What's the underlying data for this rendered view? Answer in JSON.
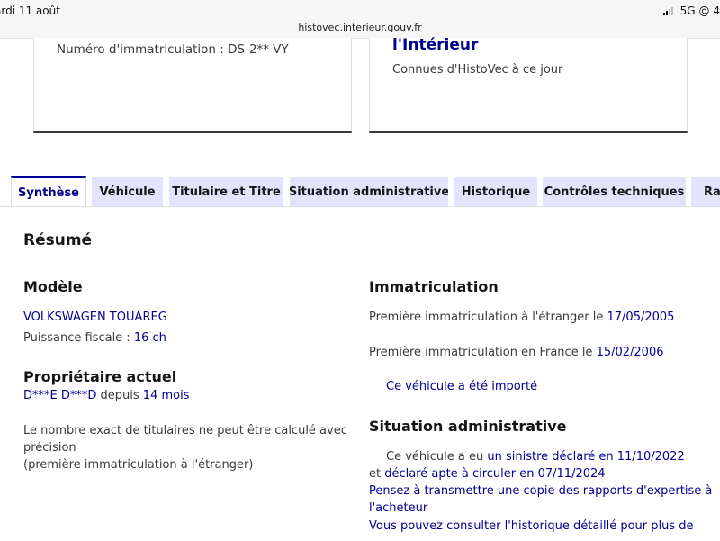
{
  "status_bar": {
    "time": "ardi 11 août",
    "url": "histovec.interieur.gouv.fr",
    "network": "5G",
    "right_extra": "@ 4"
  },
  "card_left": {
    "plate_text": "Numéro d'immatriculation : DS-2**-VY"
  },
  "card_right": {
    "title": "l'Intérieur",
    "subtitle": "Connues d'HistoVec à ce jour"
  },
  "tabs": [
    {
      "label": "Synthèse",
      "active": true
    },
    {
      "label": "Véhicule",
      "active": false
    },
    {
      "label": "Titulaire et Titre",
      "active": false
    },
    {
      "label": "Situation administrative",
      "active": false
    },
    {
      "label": "Historique",
      "active": false
    },
    {
      "label": "Contrôles techniques",
      "active": false
    },
    {
      "label": "Rap",
      "active": false
    }
  ],
  "summary": {
    "heading": "Résumé",
    "model": {
      "heading": "Modèle",
      "name": "VOLKSWAGEN TOUAREG",
      "power_label": "Puissance fiscale : ",
      "power_value": "16 ch"
    },
    "owner": {
      "heading": "Propriétaire actuel",
      "name": "D***E D***D",
      "since_label": " depuis ",
      "since_value": "14 mois",
      "note_line1": "Le nombre exact de titulaires ne peut être calculé avec",
      "note_line2": "précision",
      "note_line3": "(première immatriculation à l'étranger)"
    },
    "registration": {
      "heading": "Immatriculation",
      "foreign_label": "Première immatriculation à l'étranger le ",
      "foreign_date": "17/05/2005",
      "france_label": "Première immatriculation en France le ",
      "france_date": "15/02/2006",
      "imported": "Ce véhicule a été importé"
    },
    "admin": {
      "heading": "Situation administrative",
      "line1_prefix": "Ce véhicule a eu ",
      "line1_link": "un sinistre déclaré en 11/10/2022",
      "line2_prefix": "et ",
      "line2_link": "déclaré apte à circuler en 07/11/2024",
      "advice_line1": "Pensez à transmettre une copie des rapports d'expertise à",
      "advice_line2": "l'acheteur",
      "history_line": "Vous pouvez consulter l'historique détaillé pour plus de"
    }
  }
}
